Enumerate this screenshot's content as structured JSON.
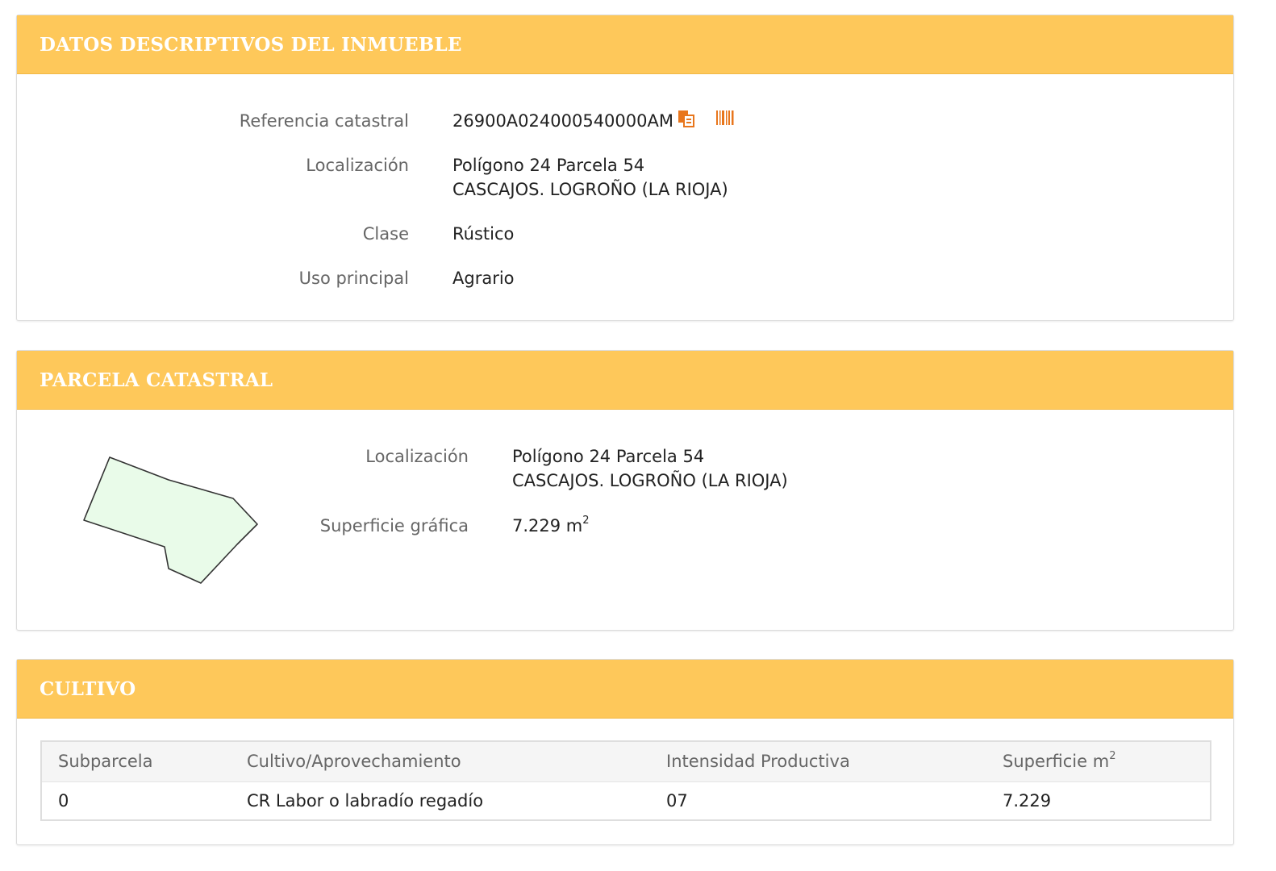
{
  "descriptive": {
    "title": "DATOS DESCRIPTIVOS DEL INMUEBLE",
    "ref_label": "Referencia catastral",
    "ref_value": "26900A024000540000AM",
    "loc_label": "Localización",
    "loc_line1": "Polígono 24 Parcela 54",
    "loc_line2": "CASCAJOS. LOGROÑO (LA RIOJA)",
    "clase_label": "Clase",
    "clase_value": "Rústico",
    "uso_label": "Uso principal",
    "uso_value": "Agrario"
  },
  "parcela": {
    "title": "PARCELA CATASTRAL",
    "loc_label": "Localización",
    "loc_line1": "Polígono 24 Parcela 54",
    "loc_line2": "CASCAJOS. LOGROÑO (LA RIOJA)",
    "sup_label": "Superficie gráfica",
    "sup_value": "7.229 m",
    "sup_exp": "2"
  },
  "cultivo": {
    "title": "CULTIVO",
    "headers": [
      "Subparcela",
      "Cultivo/Aprovechamiento",
      "Intensidad Productiva",
      "Superficie m"
    ],
    "header_exp": "2",
    "rows": [
      [
        "0",
        "CR Labor o labradío regadío",
        "07",
        "7.229"
      ]
    ]
  },
  "colors": {
    "header_bg": "#fec85a",
    "accent_icon": "#e8761c",
    "parcel_fill": "#e9fbe9"
  },
  "icons": [
    "copy-icon",
    "barcode-icon"
  ]
}
